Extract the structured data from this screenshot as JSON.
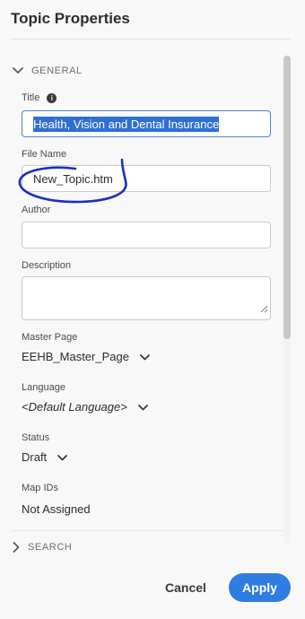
{
  "panel": {
    "title": "Topic Properties"
  },
  "general": {
    "header": "GENERAL",
    "title_label": "Title",
    "title_value": "Health, Vision and Dental Insurance",
    "filename_label": "File Name",
    "filename_value": "New_Topic.htm",
    "author_label": "Author",
    "author_value": "",
    "description_label": "Description",
    "description_value": "",
    "master_page_label": "Master Page",
    "master_page_value": "EEHB_Master_Page",
    "language_label": "Language",
    "language_value": "<Default Language>",
    "status_label": "Status",
    "status_value": "Draft",
    "map_ids_label": "Map IDs",
    "map_ids_value": "Not Assigned"
  },
  "search": {
    "header": "SEARCH"
  },
  "footer": {
    "cancel_label": "Cancel",
    "apply_label": "Apply"
  },
  "colors": {
    "accent": "#2f7de1",
    "selection": "#2f6fd4",
    "annotation_ink": "#1a2fbf"
  },
  "icons": [
    "chevron-down-icon",
    "chevron-right-icon",
    "info-icon",
    "resize-grip-icon"
  ]
}
